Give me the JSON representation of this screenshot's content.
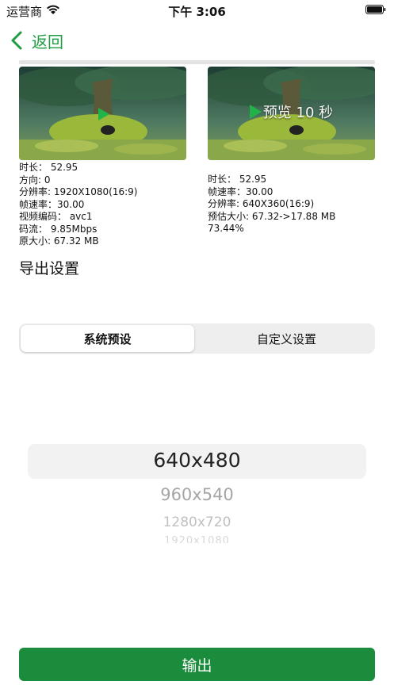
{
  "status_bar": {
    "carrier": "运营商",
    "time": "下午 3:06"
  },
  "nav": {
    "back_label": "返回"
  },
  "thumbnails": {
    "right_overlay": "预览 10 秒"
  },
  "source_info": [
    "时长： 52.95",
    "方向: 0",
    "分辨率: 1920X1080(16:9)",
    "帧速率：30.00",
    "视频编码： avc1",
    "码流： 9.85Mbps",
    "原大小: 67.32 MB"
  ],
  "output_info": [
    "时长： 52.95",
    "帧速率：30.00",
    "分辨率: 640X360(16:9)",
    "预估大小: 67.32->17.88 MB",
    "73.44%"
  ],
  "export_title": "导出设置",
  "segmented": {
    "options": [
      "系统预设",
      "自定义设置"
    ],
    "selected": "系统预设"
  },
  "picker": {
    "options": [
      "640x480",
      "960x540",
      "1280x720",
      "1920x1080"
    ],
    "selected": "640x480"
  },
  "output_button": "输出",
  "colors": {
    "accent": "#1f9d43",
    "button": "#1b8c3b",
    "play": "#22b348"
  },
  "icons": {
    "wifi": "wifi-icon",
    "battery": "battery-icon",
    "back": "chevron-left-icon",
    "play": "play-icon"
  }
}
